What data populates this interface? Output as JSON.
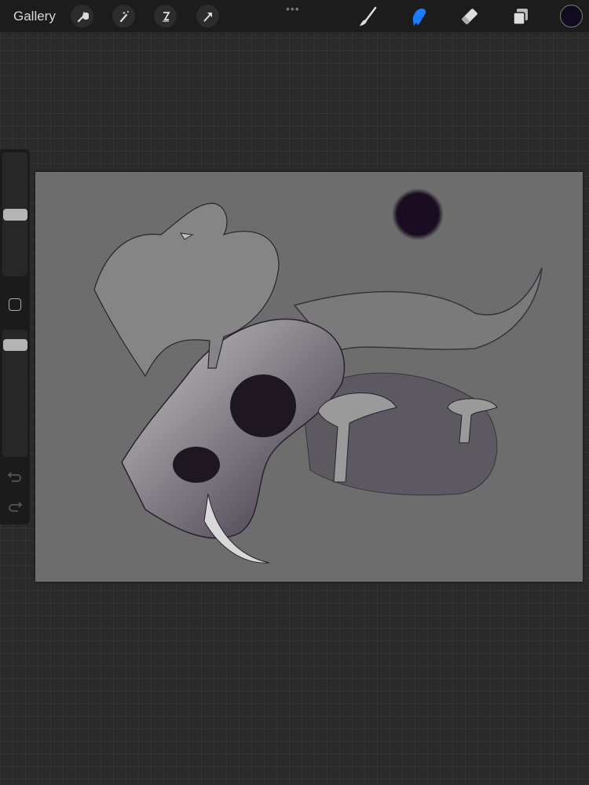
{
  "topbar": {
    "gallery_label": "Gallery",
    "more_label": "•••",
    "actions": [
      "wrench-icon",
      "magic-wand-icon",
      "selection-icon",
      "transform-arrow-icon"
    ],
    "tools": [
      "brush-icon",
      "smudge-icon",
      "eraser-icon",
      "layers-icon"
    ],
    "active_tool": "smudge",
    "accent_color": "#1a7cff",
    "current_color": "#120a20"
  },
  "sidebar": {
    "brush_size": 0.5,
    "opacity": 0.92
  }
}
